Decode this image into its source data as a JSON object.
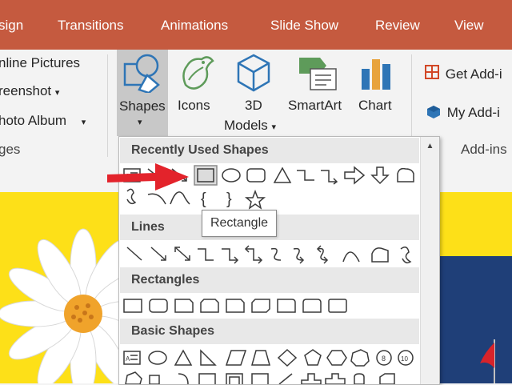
{
  "tabs": [
    "sign",
    "Transitions",
    "Animations",
    "Slide Show",
    "Review",
    "View"
  ],
  "ribbon": {
    "pictures_group": {
      "items": [
        "nline Pictures",
        "reenshot",
        "hoto Album"
      ],
      "dropdown_glyph": "▾",
      "group_label": "ges"
    },
    "illustrations": {
      "shapes_label": "Shapes",
      "icons_label": "Icons",
      "models_line1": "3D",
      "models_line2": "Models",
      "smartart_label": "SmartArt",
      "chart_label": "Chart",
      "dropdown_glyph": "▾"
    },
    "addins_group": {
      "get_addins": "Get Add-i",
      "my_addins": "My Add-i",
      "group_label": "Add-ins"
    }
  },
  "shapes_menu": {
    "categories": [
      "Recently Used Shapes",
      "Lines",
      "Rectangles",
      "Basic Shapes"
    ],
    "scroll_up_glyph": "▲",
    "tooltip": "Rectangle"
  },
  "colors": {
    "tab_bar": "#c55a3f",
    "ribbon": "#f3f3f3",
    "slide_background": "#fde018",
    "arrow": "#e3232b",
    "shape_stroke": "#3a3a3a"
  },
  "icons": [
    "shapes-icon",
    "icons-icon",
    "3d-models-icon",
    "smartart-icon",
    "chart-icon",
    "get-addins-icon",
    "my-addins-icon",
    "red-arrow-icon",
    "daisy-flower-icon"
  ]
}
